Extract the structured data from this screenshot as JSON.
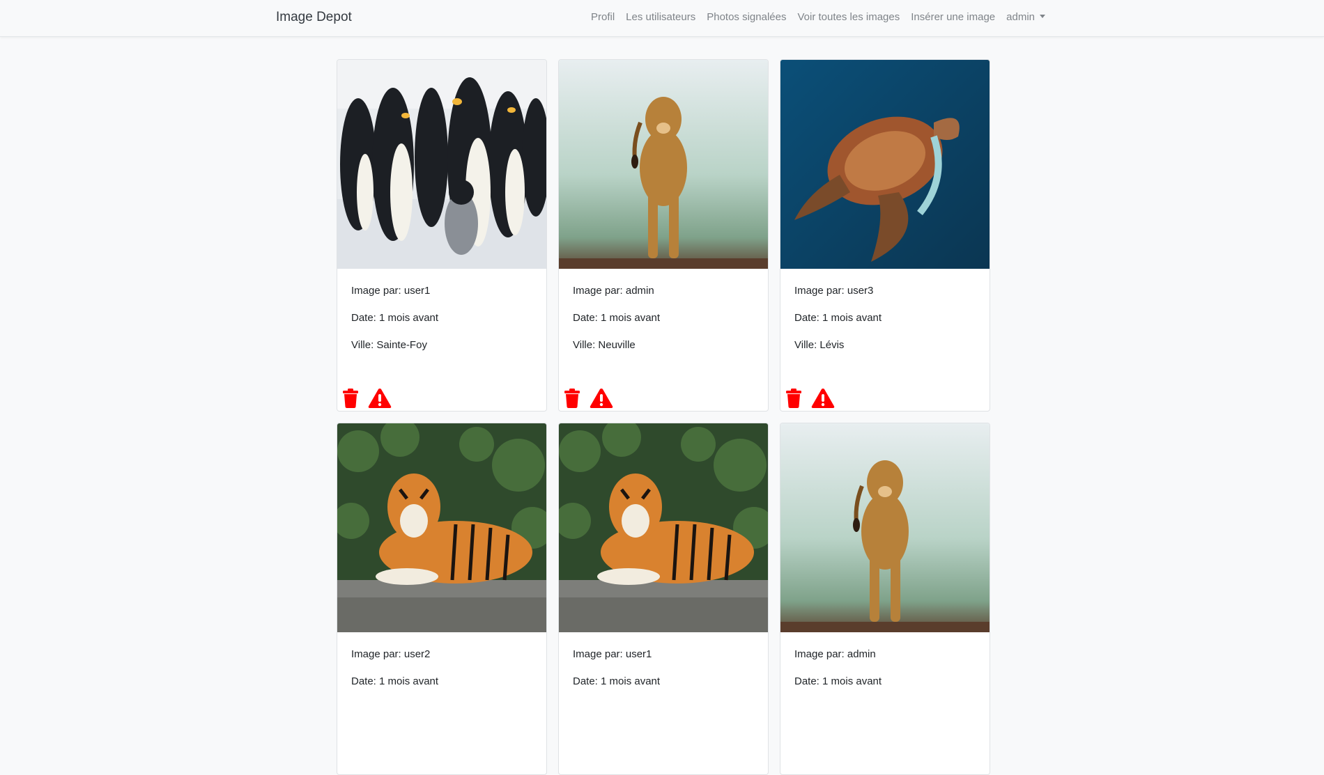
{
  "brand": "Image Depot",
  "nav": {
    "profil": "Profil",
    "utilisateurs": "Les utilisateurs",
    "signalees": "Photos signalées",
    "toutes": "Voir toutes les images",
    "inserer": "Insérer une image",
    "user_menu": "admin"
  },
  "colors": {
    "navbar_bg": "#f8f9fa",
    "action_red": "#ff0000",
    "nav_link": "#7f8489"
  },
  "icons": {
    "delete": "trash-icon",
    "report": "warning-icon"
  },
  "cards": [
    {
      "subject": "penguins",
      "author": "Image par: user1",
      "date": "Date: 1 mois avant",
      "city": "Ville: Sainte-Foy"
    },
    {
      "subject": "lioness",
      "author": "Image par: admin",
      "date": "Date: 1 mois avant",
      "city": "Ville: Neuville"
    },
    {
      "subject": "sea-turtle",
      "author": "Image par: user3",
      "date": "Date: 1 mois avant",
      "city": "Ville: Lévis"
    },
    {
      "subject": "tiger",
      "author": "Image par: user2",
      "date": "Date: 1 mois avant",
      "city": ""
    },
    {
      "subject": "tiger",
      "author": "Image par: user1",
      "date": "Date: 1 mois avant",
      "city": ""
    },
    {
      "subject": "lioness",
      "author": "Image par: admin",
      "date": "Date: 1 mois avant",
      "city": ""
    }
  ]
}
